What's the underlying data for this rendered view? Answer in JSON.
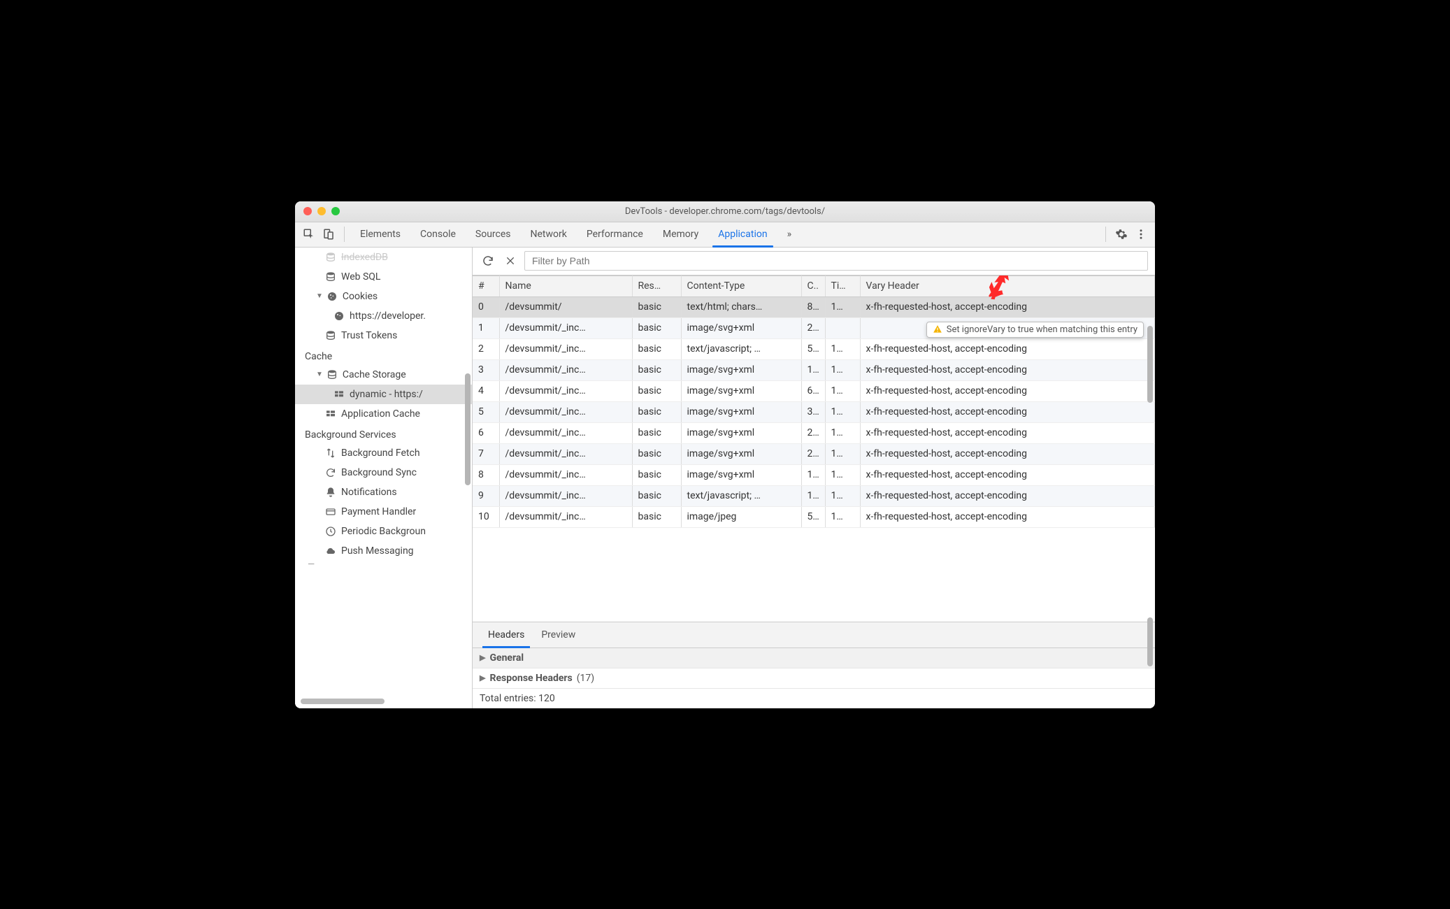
{
  "window": {
    "title": "DevTools - developer.chrome.com/tags/devtools/"
  },
  "tabs": {
    "items": [
      "Elements",
      "Console",
      "Sources",
      "Network",
      "Performance",
      "Memory",
      "Application"
    ],
    "active": "Application",
    "overflow": "»"
  },
  "sidebar": {
    "truncated_top": "IndexedDB",
    "storage": {
      "web_sql": "Web SQL",
      "cookies": "Cookies",
      "cookies_child": "https://developer.",
      "trust_tokens": "Trust Tokens"
    },
    "cache_heading": "Cache",
    "cache": {
      "cache_storage": "Cache Storage",
      "cache_storage_child": "dynamic - https:/",
      "application_cache": "Application Cache"
    },
    "bg_heading": "Background Services",
    "bg": {
      "fetch": "Background Fetch",
      "sync": "Background Sync",
      "notifications": "Notifications",
      "payment": "Payment Handler",
      "periodic": "Periodic Backgroun",
      "push": "Push Messaging"
    }
  },
  "toolbar": {
    "filter_placeholder": "Filter by Path"
  },
  "table": {
    "headers": {
      "idx": "#",
      "name": "Name",
      "response": "Res…",
      "content_type": "Content-Type",
      "c": "C..",
      "time": "Ti…",
      "vary": "Vary Header"
    },
    "rows": [
      {
        "idx": "0",
        "name": "/devsummit/",
        "resp": "basic",
        "ct": "text/html; chars…",
        "c": "8…",
        "t": "1…",
        "vary": "x-fh-requested-host, accept-encoding",
        "selected": true
      },
      {
        "idx": "1",
        "name": "/devsummit/_inc…",
        "resp": "basic",
        "ct": "image/svg+xml",
        "c": "2…",
        "t": "",
        "vary": ""
      },
      {
        "idx": "2",
        "name": "/devsummit/_inc…",
        "resp": "basic",
        "ct": "text/javascript; …",
        "c": "5…",
        "t": "1…",
        "vary": "x-fh-requested-host, accept-encoding"
      },
      {
        "idx": "3",
        "name": "/devsummit/_inc…",
        "resp": "basic",
        "ct": "image/svg+xml",
        "c": "1…",
        "t": "1…",
        "vary": "x-fh-requested-host, accept-encoding"
      },
      {
        "idx": "4",
        "name": "/devsummit/_inc…",
        "resp": "basic",
        "ct": "image/svg+xml",
        "c": "6…",
        "t": "1…",
        "vary": "x-fh-requested-host, accept-encoding"
      },
      {
        "idx": "5",
        "name": "/devsummit/_inc…",
        "resp": "basic",
        "ct": "image/svg+xml",
        "c": "3…",
        "t": "1…",
        "vary": "x-fh-requested-host, accept-encoding"
      },
      {
        "idx": "6",
        "name": "/devsummit/_inc…",
        "resp": "basic",
        "ct": "image/svg+xml",
        "c": "2…",
        "t": "1…",
        "vary": "x-fh-requested-host, accept-encoding"
      },
      {
        "idx": "7",
        "name": "/devsummit/_inc…",
        "resp": "basic",
        "ct": "image/svg+xml",
        "c": "2…",
        "t": "1…",
        "vary": "x-fh-requested-host, accept-encoding"
      },
      {
        "idx": "8",
        "name": "/devsummit/_inc…",
        "resp": "basic",
        "ct": "image/svg+xml",
        "c": "1…",
        "t": "1…",
        "vary": "x-fh-requested-host, accept-encoding"
      },
      {
        "idx": "9",
        "name": "/devsummit/_inc…",
        "resp": "basic",
        "ct": "text/javascript; …",
        "c": "1…",
        "t": "1…",
        "vary": "x-fh-requested-host, accept-encoding"
      },
      {
        "idx": "10",
        "name": "/devsummit/_inc…",
        "resp": "basic",
        "ct": "image/jpeg",
        "c": "5…",
        "t": "1…",
        "vary": "x-fh-requested-host, accept-encoding"
      }
    ]
  },
  "tooltip": "Set ignoreVary to true when matching this entry",
  "detail": {
    "tabs": {
      "headers": "Headers",
      "preview": "Preview"
    },
    "general": "General",
    "response_headers": "Response Headers",
    "response_headers_count": "(17)",
    "totals": "Total entries: 120"
  }
}
